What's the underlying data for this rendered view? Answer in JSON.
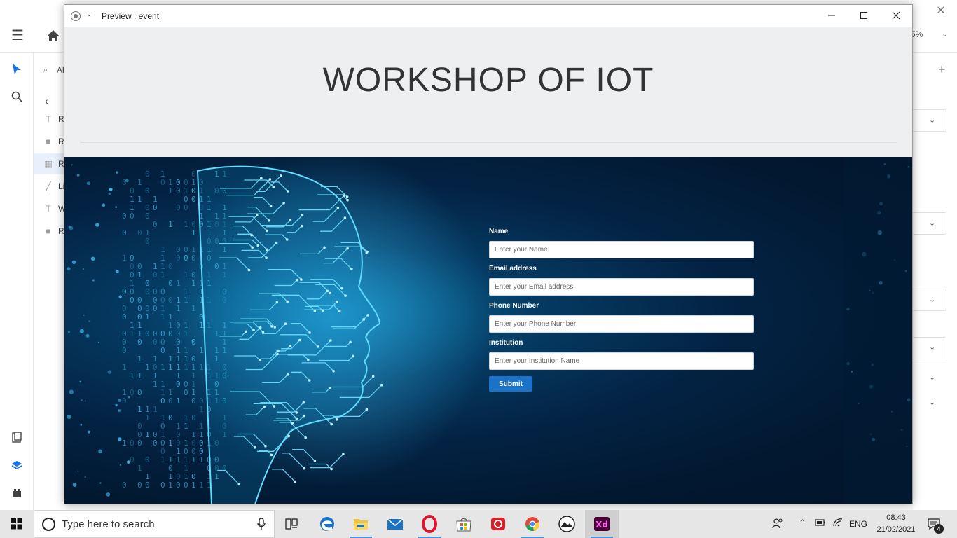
{
  "xd_app": {
    "zoom": "5%",
    "layers": [
      {
        "icon": "T",
        "label": "R"
      },
      {
        "icon": "■",
        "label": "R"
      },
      {
        "icon": "▦",
        "label": "R"
      },
      {
        "icon": "╱",
        "label": "Li"
      },
      {
        "icon": "T",
        "label": "W"
      },
      {
        "icon": "■",
        "label": "R"
      }
    ],
    "search_placeholder": "Al",
    "breadcrumb_back": "‹"
  },
  "preview_window": {
    "title": "Preview : event",
    "heading": "WORKSHOP OF IOT"
  },
  "form": {
    "name_label": "Name",
    "name_placeholder": "Enter your Name",
    "email_label": "Email address",
    "email_placeholder": "Enter your Email address",
    "phone_label": "Phone Number",
    "phone_placeholder": "Enter your Phone Number",
    "institution_label": "Institution",
    "institution_placeholder": "Enter your Institution Name",
    "submit_label": "Submit"
  },
  "taskbar": {
    "search_placeholder": "Type here to search",
    "language": "ENG",
    "time": "08:43",
    "date": "21/02/2021",
    "notification_count": "4",
    "apps": [
      "task-view",
      "edge",
      "file-explorer",
      "mail",
      "opera",
      "store",
      "creative-cloud",
      "chrome",
      "photos",
      "adobe-xd"
    ],
    "xd_label": "Xd"
  },
  "colors": {
    "accent_blue": "#1a73c9",
    "xd_pink": "#ff61f6",
    "xd_bg": "#470137",
    "hero_dark": "#021830",
    "hero_glow": "#0a6a9a"
  }
}
